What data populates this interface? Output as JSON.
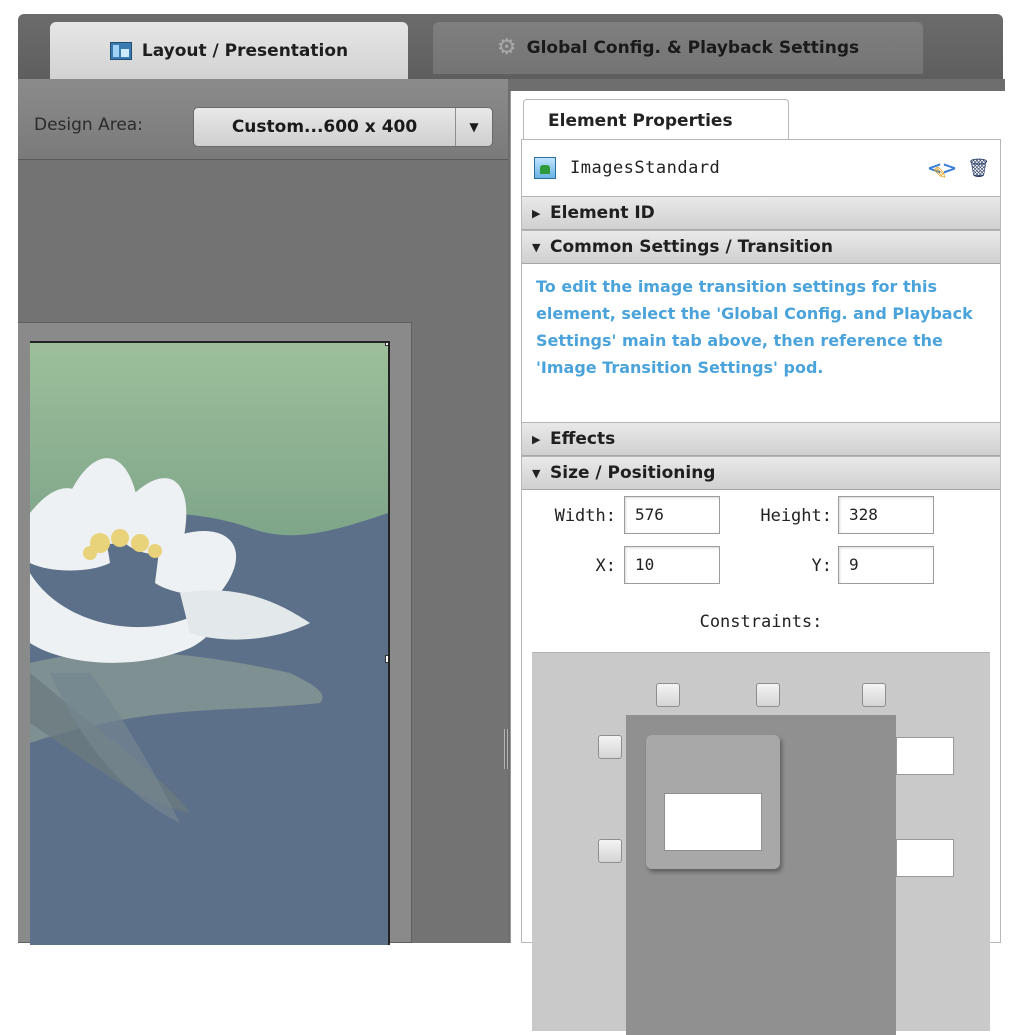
{
  "main_tabs": [
    {
      "label": "Layout / Presentation",
      "icon": "layout-icon",
      "active": true
    },
    {
      "label": "Global Config. & Playback Settings",
      "icon": "gear-icon",
      "active": false
    }
  ],
  "design_area": {
    "label": "Design Area:",
    "selected": "Custom...600 x 400"
  },
  "properties": {
    "tab_label": "Element Properties",
    "element_name": "ImagesStandard",
    "sections": {
      "element_id": "Element ID",
      "common_settings": "Common Settings / Transition",
      "effects": "Effects",
      "size_positioning": "Size / Positioning"
    },
    "transition_info": "To edit the image transition settings for this element, select the 'Global Config. and Playback Settings' main tab above, then reference the 'Image Transition Settings' pod.",
    "size": {
      "width_label": "Width:",
      "width_value": "576",
      "height_label": "Height:",
      "height_value": "328",
      "x_label": "X:",
      "x_value": "10",
      "y_label": "Y:",
      "y_value": "9",
      "constraints_label": "Constraints:"
    }
  },
  "colors": {
    "info_text": "#4aa3db",
    "workspace": "#6e6e6e"
  }
}
